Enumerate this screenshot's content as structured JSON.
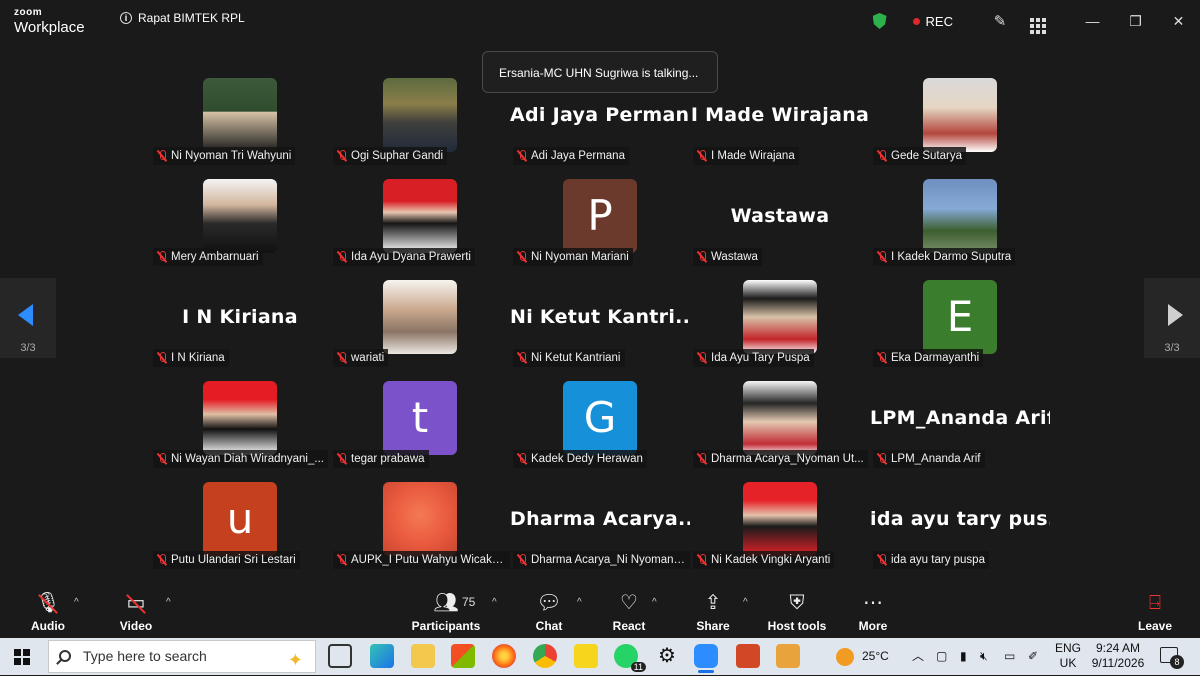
{
  "app": {
    "brand_top": "zoom",
    "brand_bottom": "Workplace",
    "meeting_title": "Rapat BIMTEK RPL",
    "rec_label": "REC"
  },
  "toast": "Ersania-MC UHN Sugriwa is talking...",
  "pager": {
    "left": "3/3",
    "right": "3/3"
  },
  "tiles": [
    {
      "name": "Ni Nyoman Tri Wahyuni",
      "type": "photo",
      "photo": "p1"
    },
    {
      "name": "Ogi Suphar Gandi",
      "type": "photo",
      "photo": "p2"
    },
    {
      "name": "Adi Jaya Permana",
      "type": "text",
      "display": "Adi Jaya Permana"
    },
    {
      "name": "I Made Wirajana",
      "type": "text",
      "display": "I Made Wirajana"
    },
    {
      "name": "Gede Sutarya",
      "type": "photo",
      "photo": "p3"
    },
    {
      "name": "Mery Ambarnuari",
      "type": "photo",
      "photo": "p4"
    },
    {
      "name": "Ida Ayu Dyana Prawerti",
      "type": "photo",
      "photo": "p5"
    },
    {
      "name": "Ni Nyoman Mariani",
      "type": "letter",
      "letter": "P",
      "color": "#6b3a2c"
    },
    {
      "name": "Wastawa",
      "type": "text",
      "display": "Wastawa"
    },
    {
      "name": "I Kadek Darmo Suputra",
      "type": "photo",
      "photo": "p6"
    },
    {
      "name": "I N Kiriana",
      "type": "text",
      "display": "I N Kiriana"
    },
    {
      "name": "wariati",
      "type": "photo",
      "photo": "p7"
    },
    {
      "name": "Ni Ketut Kantriani",
      "type": "text",
      "display": "Ni Ketut Kantri..."
    },
    {
      "name": "Ida Ayu Tary Puspa",
      "type": "photo",
      "photo": "p8"
    },
    {
      "name": "Eka Darmayanthi",
      "type": "letter",
      "letter": "E",
      "color": "#3a7d2c"
    },
    {
      "name": "Ni Wayan Diah Wiradnyani_...",
      "type": "photo",
      "photo": "p9"
    },
    {
      "name": "tegar prabawa",
      "type": "letter",
      "letter": "t",
      "color": "#7b52c9"
    },
    {
      "name": "Kadek Dedy Herawan",
      "type": "letter",
      "letter": "G",
      "color": "#1690d8"
    },
    {
      "name": "Dharma Acarya_Nyoman Ut...",
      "type": "photo",
      "photo": "p10"
    },
    {
      "name": "LPM_Ananda Arif",
      "type": "text",
      "display": "LPM_Ananda Arif"
    },
    {
      "name": "Putu Ulandari Sri Lestari",
      "type": "letter",
      "letter": "u",
      "color": "#c4401f"
    },
    {
      "name": "AUPK_I Putu Wahyu Wicaks...",
      "type": "photo",
      "photo": "p11"
    },
    {
      "name": "Dharma Acarya_Ni Nyoman ...",
      "type": "text",
      "display": "Dharma  Acarya..."
    },
    {
      "name": "Ni Kadek Vingki Aryanti",
      "type": "photo",
      "photo": "p12"
    },
    {
      "name": "ida ayu tary puspa",
      "type": "text",
      "display": "ida ayu tary pus..."
    }
  ],
  "toolbar": {
    "audio": "Audio",
    "video": "Video",
    "participants": "Participants",
    "participants_count": "75",
    "chat": "Chat",
    "react": "React",
    "share": "Share",
    "host_tools": "Host tools",
    "more": "More",
    "leave": "Leave"
  },
  "taskbar": {
    "search_placeholder": "Type here to search",
    "weather": "25°C",
    "lang_top": "ENG",
    "lang_bottom": "UK",
    "time": "9:24 AM",
    "date": "9/11/2026",
    "whatsapp_badge": "11",
    "notif_count": "8"
  },
  "colors": {
    "accent": "#2d8cff",
    "rec": "#e02828",
    "shield": "#2bb24c"
  }
}
